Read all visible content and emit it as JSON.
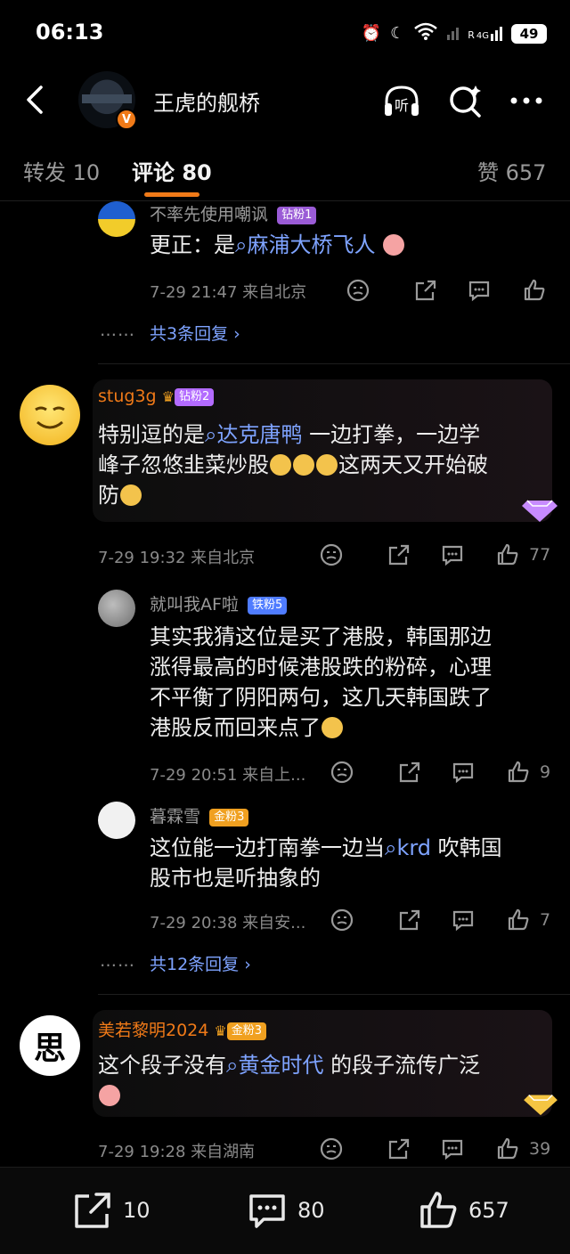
{
  "status": {
    "time": "06:13",
    "network": "4G",
    "signal_label": "R",
    "battery": "49"
  },
  "header": {
    "title": "王虎的舰桥",
    "verified": "V"
  },
  "tabs": [
    {
      "label": "转发 10"
    },
    {
      "label": "评论 80"
    },
    {
      "label": "赞 657"
    }
  ],
  "comment0": {
    "user": "不率先使用嘲讽",
    "badge": "钻粉1",
    "text_prefix": "更正：是",
    "link": "麻浦大桥飞人",
    "meta": "7-29 21:47  来自北京",
    "more": "共3条回复 ›",
    "dots": "……"
  },
  "comment1": {
    "user": "stug3g",
    "badge": "钻粉2",
    "text_prefix": "特别逗的是",
    "link": "达克唐鸭",
    "text_suffix_1": " 一边打拳，一边学",
    "text_line2": "峰子忽悠韭菜炒股",
    "text_line2_tail": "这两天又开始破",
    "text_line3": "防",
    "meta": "7-29 19:32  来自北京",
    "likes": "77",
    "replies": [
      {
        "user": "就叫我AF啦",
        "badge": "铁粉5",
        "lines": [
          "其实我猜这位是买了港股，韩国那边",
          "涨得最高的时候港股跌的粉碎，心理",
          "不平衡了阴阳两句，这几天韩国跌了",
          "港股反而回来点了"
        ],
        "meta": "7-29 20:51  来自上...",
        "likes": "9"
      },
      {
        "user": "暮霖雪",
        "badge": "金粉3",
        "line1_prefix": "这位能一边打南拳一边当",
        "link": "krd",
        "line1_suffix": " 吹韩国",
        "line2": "股市也是听抽象的",
        "meta": "7-29 20:38  来自安...",
        "likes": "7"
      }
    ],
    "more": "共12条回复 ›",
    "dots": "……"
  },
  "comment2": {
    "user": "美若黎明2024",
    "badge": "金粉3",
    "avatar_char": "思",
    "text_prefix": "这个段子没有",
    "link": "黄金时代",
    "text_suffix": " 的段子流传广泛",
    "meta": "7-29 19:28  来自湖南",
    "likes": "39"
  },
  "bottom": {
    "repost": "10",
    "comment": "80",
    "like": "657"
  },
  "colors": {
    "accent": "#f07a18",
    "link": "#7ea3ff",
    "diamond_badge": "#b36bff",
    "iron_badge": "#4f7cff",
    "gold_badge": "#f0a020"
  }
}
